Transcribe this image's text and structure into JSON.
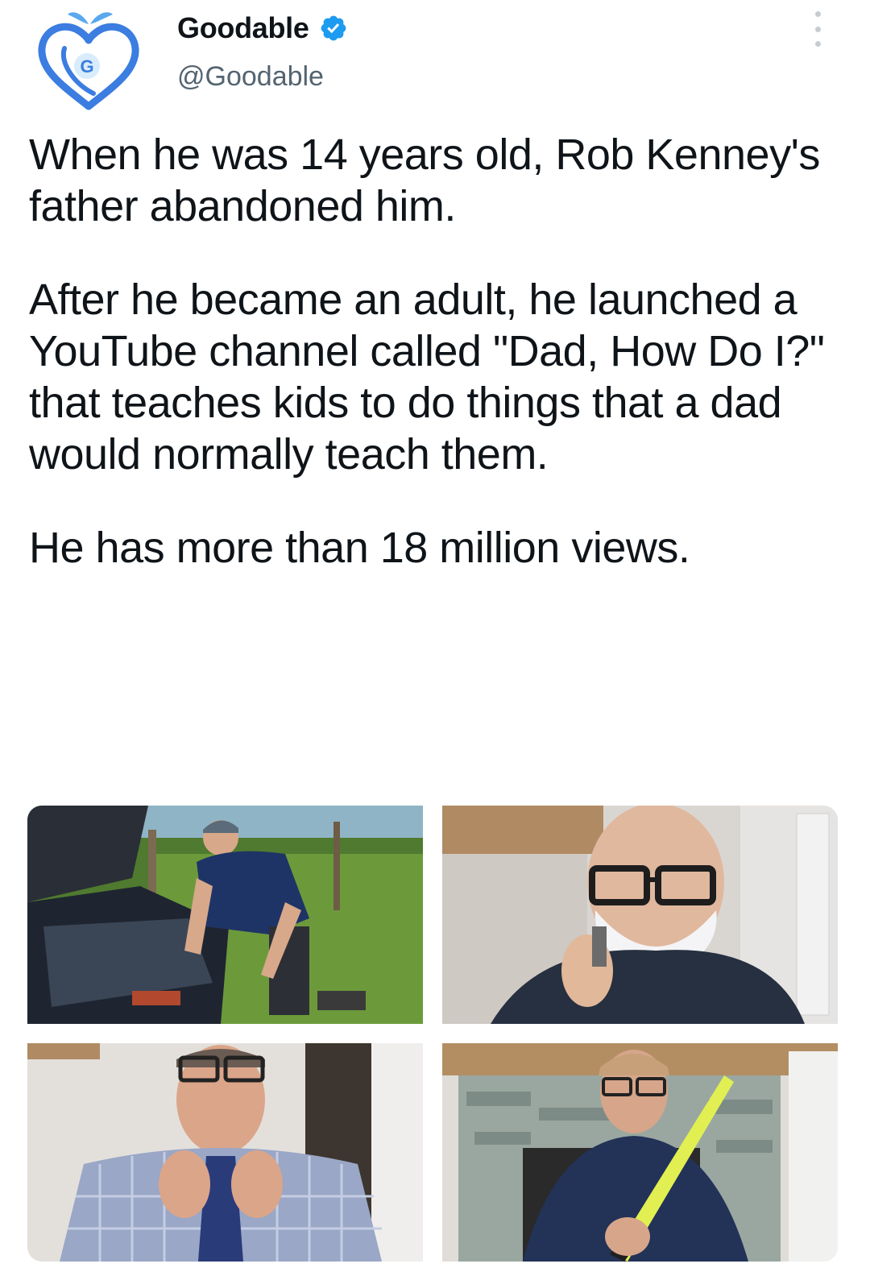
{
  "author": {
    "display_name": "Goodable",
    "handle": "@Goodable",
    "verified": true,
    "avatar_letter": "G",
    "avatar_color": "#3b7de0",
    "avatar_leaf_color": "#5aa8ee"
  },
  "tweet": {
    "paragraphs": [
      "When he was 14 years old, Rob Kenney's father abandoned him.",
      "After he became an adult, he launched a YouTube channel called \"Dad, How Do I?\" that teaches kids to do things that a dad would normally teach them.",
      "He has more than 18 million views."
    ]
  },
  "media": {
    "count": 4,
    "items": [
      {
        "subject": "car-repair-photo"
      },
      {
        "subject": "shaving-photo"
      },
      {
        "subject": "tie-tying-photo"
      },
      {
        "subject": "flashlight-photo"
      }
    ]
  },
  "colors": {
    "text_primary": "#0f1419",
    "text_secondary": "#536471",
    "verified_blue": "#1d9bf0"
  },
  "icons": {
    "verified": "verified-badge-icon",
    "more": "more-options-icon"
  }
}
